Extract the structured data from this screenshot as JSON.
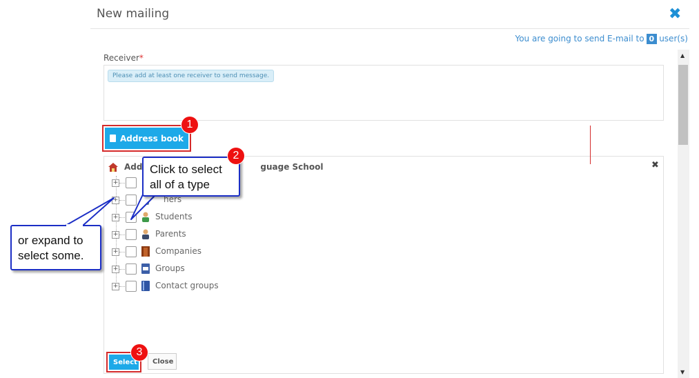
{
  "dialog": {
    "title": "New mailing",
    "send_info_prefix": "You are going to send E-mail to",
    "send_count": "0",
    "send_info_suffix": "user(s)"
  },
  "receiver": {
    "label": "Receiver",
    "required_mark": "*",
    "hint": "Please add at least one receiver to send message."
  },
  "address_book_button": "Address book",
  "address_panel": {
    "title_start": "Addr",
    "title_end": "guage School",
    "items": [
      {
        "label": ""
      },
      {
        "label": "hers"
      },
      {
        "label": "Students"
      },
      {
        "label": "Parents"
      },
      {
        "label": "Companies"
      },
      {
        "label": "Groups"
      },
      {
        "label": "Contact groups"
      }
    ],
    "select_button": "Select",
    "close_button": "Close"
  },
  "annotations": {
    "badge_1": "1",
    "badge_2": "2",
    "badge_3": "3",
    "callout_1_line1": "Click to select",
    "callout_1_line2": "all of a type",
    "callout_2_line1": "or expand to",
    "callout_2_line2": "select some."
  },
  "colors": {
    "accent": "#1da9e8",
    "highlight": "#d42a2a",
    "callout_border": "#1b2ec5"
  }
}
